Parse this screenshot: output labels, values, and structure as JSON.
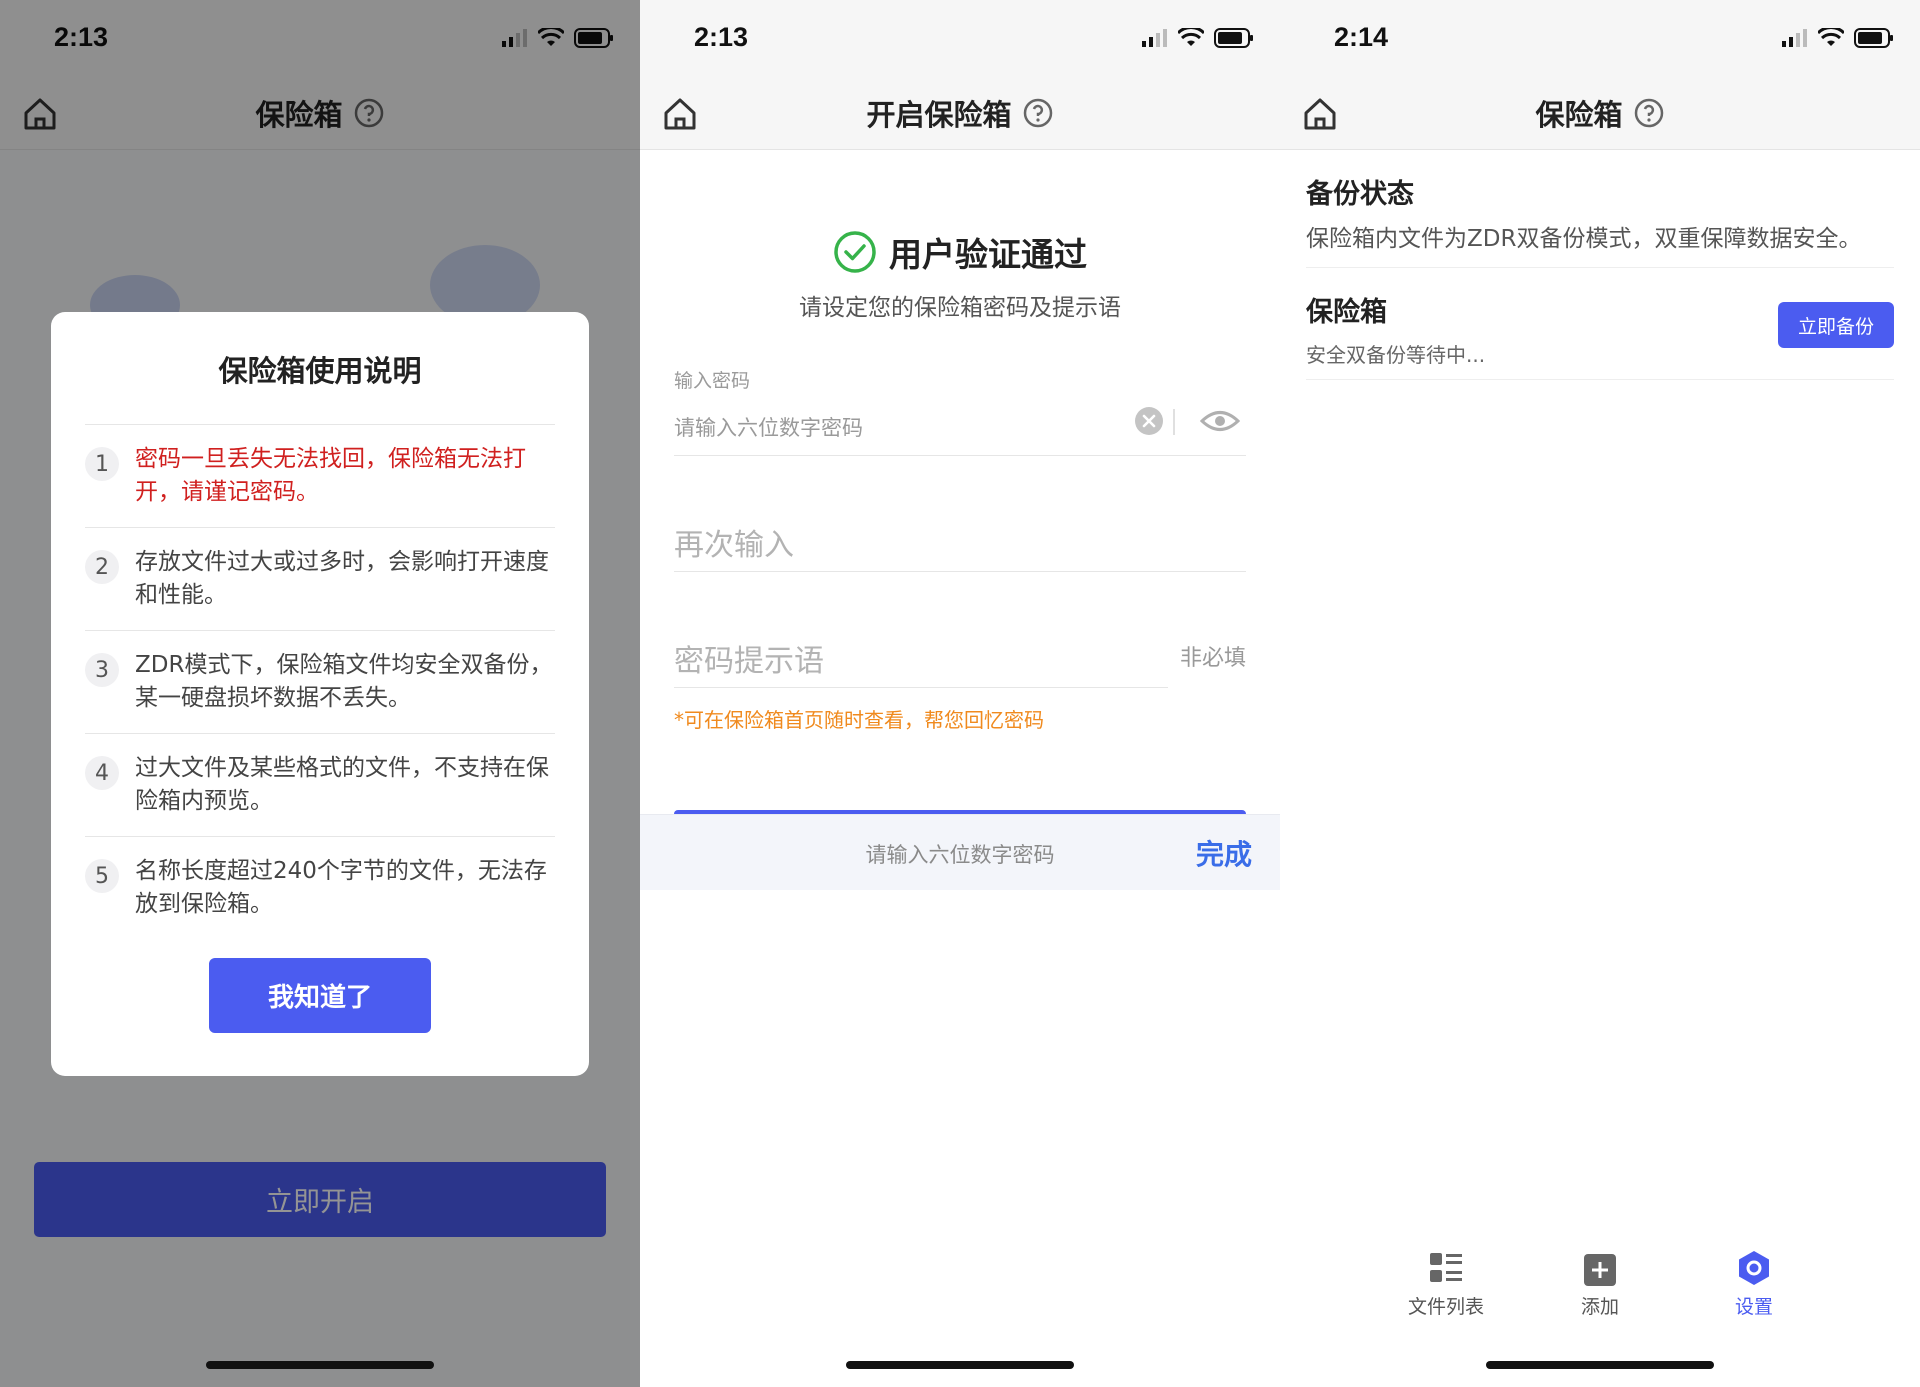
{
  "colors": {
    "accent": "#4b5cf0",
    "warning_red": "#d0201f",
    "hint_orange": "#f08a1e",
    "success_green": "#36b34a",
    "done_blue": "#3a6de8"
  },
  "screen1": {
    "time": "2:13",
    "nav_title": "保险箱",
    "dialog": {
      "title": "保险箱使用说明",
      "items": [
        {
          "num": "1",
          "text": "密码一旦丢失无法找回，保险箱无法打开，请谨记密码。"
        },
        {
          "num": "2",
          "text": "存放文件过大或过多时，会影响打开速度和性能。"
        },
        {
          "num": "3",
          "text": "ZDR模式下，保险箱文件均安全双备份，某一硬盘损坏数据不丢失。"
        },
        {
          "num": "4",
          "text": "过大文件及某些格式的文件，不支持在保险箱内预览。"
        },
        {
          "num": "5",
          "text": "名称长度超过240个字节的文件，无法存放到保险箱。"
        }
      ],
      "confirm_label": "我知道了"
    },
    "open_button_label": "立即开启"
  },
  "screen2": {
    "time": "2:13",
    "nav_title": "开启保险箱",
    "verify_title": "用户验证通过",
    "verify_subtitle": "请设定您的保险箱密码及提示语",
    "password_label": "输入密码",
    "password_placeholder": "请输入六位数字密码",
    "confirm_placeholder": "再次输入",
    "hint_placeholder": "密码提示语",
    "hint_optional": "非必填",
    "hint_note": "*可在保险箱首页随时查看，帮您回忆密码",
    "keyboard_placeholder": "请输入六位数字密码",
    "keyboard_done": "完成"
  },
  "screen3": {
    "time": "2:14",
    "nav_title": "保险箱",
    "backup_status_title": "备份状态",
    "backup_status_desc": "保险箱内文件为ZDR双备份模式，双重保障数据安全。",
    "vault_title": "保险箱",
    "vault_desc": "安全双备份等待中...",
    "backup_button": "立即备份",
    "tabs": [
      {
        "label": "文件列表",
        "icon": "file-list-icon"
      },
      {
        "label": "添加",
        "icon": "add-icon"
      },
      {
        "label": "设置",
        "icon": "settings-icon"
      }
    ]
  }
}
